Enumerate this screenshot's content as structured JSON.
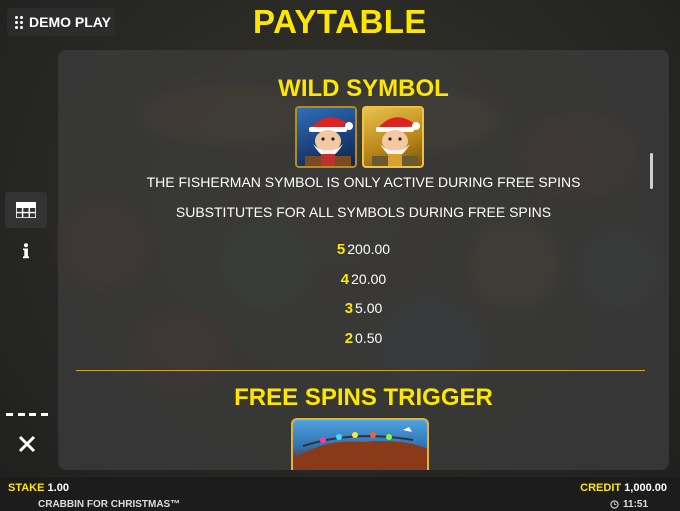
{
  "header": {
    "demo_label": "DEMO PLAY",
    "title": "PAYTABLE"
  },
  "sidebar": {
    "items": [
      {
        "icon": "paytable-grid-icon",
        "selected": true
      },
      {
        "icon": "info-icon",
        "selected": false
      }
    ],
    "close_icon": "close-icon"
  },
  "wild": {
    "title": "WILD SYMBOL",
    "description_1": "THE FISHERMAN SYMBOL IS ONLY ACTIVE DURING FREE SPINS",
    "description_2": "SUBSTITUTES FOR ALL SYMBOLS DURING FREE SPINS",
    "payouts": [
      {
        "count": "5",
        "value": "200.00"
      },
      {
        "count": "4",
        "value": "20.00"
      },
      {
        "count": "3",
        "value": "5.00"
      },
      {
        "count": "2",
        "value": "0.50"
      }
    ]
  },
  "free_spins": {
    "title": "FREE SPINS TRIGGER"
  },
  "footer": {
    "stake_label": "STAKE",
    "stake_value": "1.00",
    "credit_label": "CREDIT",
    "credit_value": "1,000.00",
    "game_name": "CRABBIN FOR CHRISTMAS™",
    "time": "11:51"
  },
  "colors": {
    "accent": "#ffe600",
    "panel": "#3a3a3a",
    "background": "#232323"
  }
}
